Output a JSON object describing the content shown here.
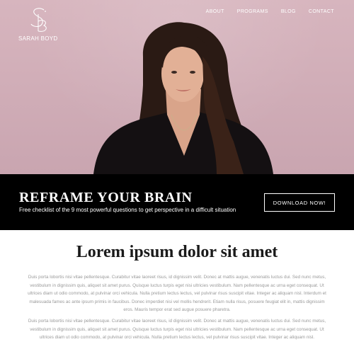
{
  "site": {
    "logo_name": "SARAH BOYD",
    "nav": [
      "ABOUT",
      "PROGRAMS",
      "BLOG",
      "CONTACT"
    ]
  },
  "banner": {
    "title": "REFRAME YOUR BRAIN",
    "subtitle": "Free checklist of the 9 most powerful questions to get perspective in a difficult situation",
    "cta_label": "DOWNLOAD NOW!"
  },
  "content": {
    "title": "Lorem ipsum dolor sit amet",
    "paragraph_1": "Duis porta lobortis nisi vitae pellentesque. Curabitur vitae laoreet risus, id dignissim velit. Donec at mattis augue, venenatis luctus dui. Sed nunc metus, vestibulum in dignissim quis, aliquet sit amet purus. Quisque luctus turpis eget nisi ultricies vestibulum. Nam pellentesque ac urna eget consequat. Ut ultrices diam ut odio commodo, at pulvinar orci vehicula. Nulla pretium lectus lectus, vel pulvinar risus suscipit vitae. Integer ac aliquam nisl. Interdum et malesuada fames ac ante ipsum primis in faucibus. Donec imperdiet nisi vel mollis hendrerit. Etiam nulla risus, posuere feugiat elit in, mattis dignissim eros. Mauris tempor erat sed augue posuere pharetra.",
    "paragraph_2": "Duis porta lobortis nisi vitae pellentesque. Curabitur vitae laoreet risus, id dignissim velit. Donec at mattis augue, venenatis luctus dui. Sed nunc metus, vestibulum in dignissim quis, aliquet sit amet purus. Quisque luctus turpis eget nisi ultricies vestibulum. Nam pellentesque ac urna eget consequat. Ut ultrices diam ut odio commodo, at pulvinar orci vehicula. Nulla pretium lectus lectus, vel pulvinar risus suscipit vitae. Integer ac aliquam nisl."
  },
  "colors": {
    "hero_wall": "#d1aeb8",
    "banner_bg": "#000000",
    "body_text": "#9a9a9a",
    "heading_text": "#1a1a1a"
  },
  "icons": {
    "logo_mark": "sb-monogram-icon"
  }
}
